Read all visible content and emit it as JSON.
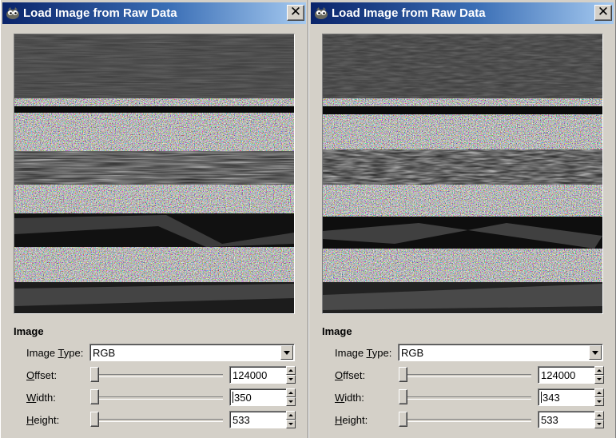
{
  "windows": [
    {
      "title": "Load Image from Raw Data",
      "close_glyph": "✕",
      "icon": "gimp-icon",
      "section_label": "Image",
      "image_type": {
        "label_pre": "Image ",
        "label_ul": "T",
        "label_post": "ype:",
        "value": "RGB"
      },
      "offset": {
        "label_ul": "O",
        "label_post": "ffset:",
        "value": "124000"
      },
      "width": {
        "label_ul": "W",
        "label_post": "idth:",
        "value": "350"
      },
      "height": {
        "label_ul": "H",
        "label_post": "eight:",
        "value": "533"
      }
    },
    {
      "title": "Load Image from Raw Data",
      "close_glyph": "✕",
      "icon": "gimp-icon",
      "section_label": "Image",
      "image_type": {
        "label_pre": "Image ",
        "label_ul": "T",
        "label_post": "ype:",
        "value": "RGB"
      },
      "offset": {
        "label_ul": "O",
        "label_post": "ffset:",
        "value": "124000"
      },
      "width": {
        "label_ul": "W",
        "label_post": "idth:",
        "value": "343"
      },
      "height": {
        "label_ul": "H",
        "label_post": "eight:",
        "value": "533"
      }
    }
  ],
  "colors": {
    "title_gradient_start": "#0a246a",
    "title_gradient_end": "#a6caf0",
    "dialog_bg": "#d4d0c8"
  }
}
